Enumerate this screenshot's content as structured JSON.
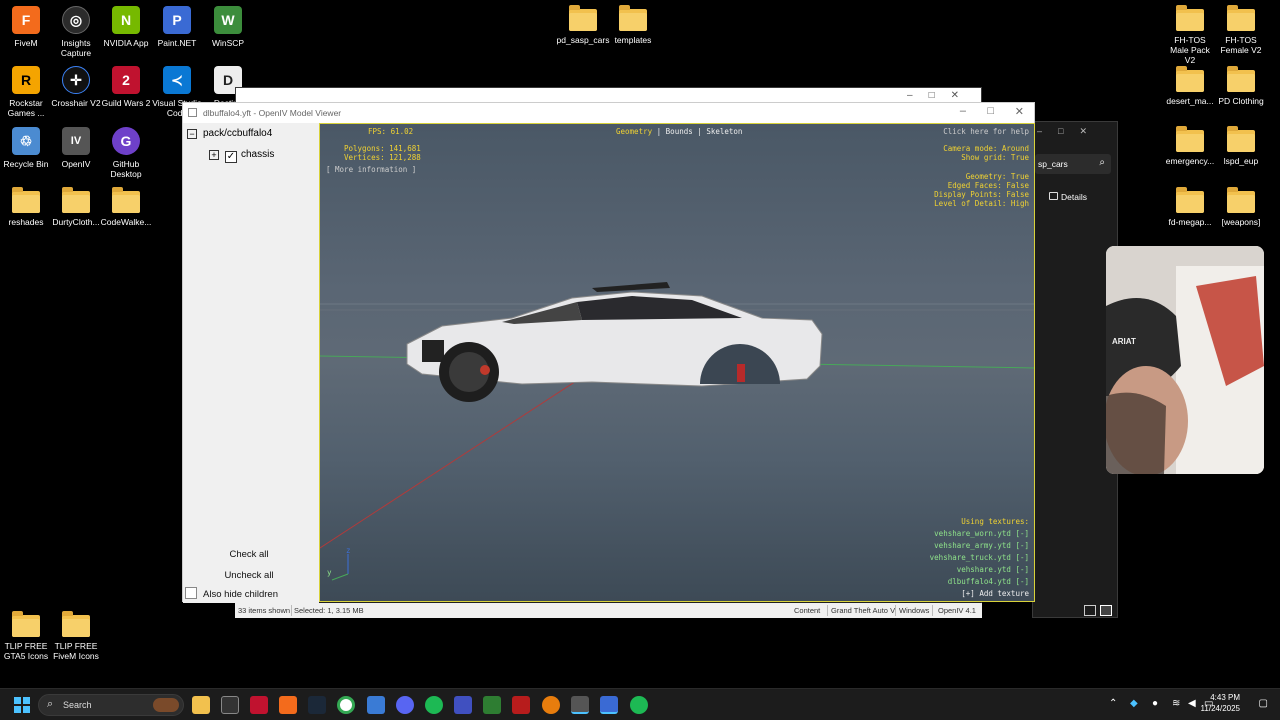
{
  "desktop": {
    "left_icons": [
      {
        "label": "FiveM",
        "color": "#f36b1c",
        "glyph": "F"
      },
      {
        "label": "Insights Capture",
        "color": "#2b2b2b",
        "glyph": "◎"
      },
      {
        "label": "NVIDIA App",
        "color": "#76b900",
        "glyph": "N"
      },
      {
        "label": "Paint.NET",
        "color": "#3a6ad4",
        "glyph": "P"
      },
      {
        "label": "WinSCP",
        "color": "#3c8d3c",
        "glyph": "W"
      },
      {
        "label": "Rockstar Games ...",
        "color": "#f4a400",
        "glyph": "R"
      },
      {
        "label": "Crosshair V2",
        "color": "#111111",
        "glyph": "✛"
      },
      {
        "label": "Guild Wars 2",
        "color": "#c0122f",
        "glyph": "2"
      },
      {
        "label": "Visual Studio Code",
        "color": "#0a78d4",
        "glyph": "≺"
      },
      {
        "label": "Destiny",
        "color": "#eeeeee",
        "glyph": "D"
      },
      {
        "label": "Recycle Bin",
        "color": "#4b8bd1",
        "glyph": "♲"
      },
      {
        "label": "OpenIV",
        "color": "#555555",
        "glyph": "IV"
      },
      {
        "label": "GitHub Desktop",
        "color": "#6e40c9",
        "glyph": "G"
      }
    ],
    "left_folders": [
      "reshades",
      "DurtyCloth...",
      "CodeWalke..."
    ],
    "bottom_left_folders": [
      "TLIP FREE GTA5 Icons",
      "TLIP FREE FiveM Icons"
    ],
    "top_center_folders": [
      "pd_sasp_cars",
      "templates"
    ],
    "right_folders": [
      "FH-TOS Male Pack V2",
      "FH-TOS Female V2",
      "desert_ma...",
      "PD Clothing",
      "emergency...",
      "lspd_eup",
      "fd-megap...",
      "[weapons]"
    ]
  },
  "explorer": {
    "search_text": "sp_cars",
    "details_label": "Details",
    "status": {
      "items_shown": "33 items shown",
      "selected": "Selected: 1,  3.15 MB",
      "content": "Content",
      "game": "Grand Theft Auto V",
      "platform": "Windows",
      "version": "OpenIV 4.1"
    }
  },
  "viewer": {
    "window_title": "dlbuffalo4.yft - OpenIV Model Viewer",
    "tree": {
      "root": "pack/ccbuffalo4",
      "child": "chassis",
      "check_all": "Check all",
      "uncheck_all": "Uncheck all",
      "also_hide": "Also hide children"
    },
    "overlay": {
      "fps": "FPS: 61.02",
      "polygons": "Polygons: 141,681",
      "vertices": "Vertices: 121,288",
      "more_info": "[ More information ]",
      "mode_geometry": "Geometry",
      "mode_sep1": "|",
      "mode_bounds": "Bounds",
      "mode_sep2": "|",
      "mode_skeleton": "Skeleton",
      "help": "Click here for help",
      "camera_mode": "Camera mode: Around",
      "show_grid": "Show grid: True",
      "geometry": "Geometry: True",
      "edged_faces": "Edged Faces: False",
      "display_points": "Display Points: False",
      "lod": "Level of Detail: High",
      "using_textures": "Using textures:",
      "textures": [
        "vehshare_worn.ytd [-]",
        "vehshare_army.ytd [-]",
        "vehshare_truck.ytd [-]",
        "vehshare.ytd [-]",
        "dlbuffalo4.ytd [-]"
      ],
      "add_texture": "[+] Add texture",
      "axis_y": "y",
      "axis_z": "z"
    }
  },
  "webcam": {
    "cap_text": "ARIAT"
  },
  "taskbar": {
    "search_placeholder": "Search",
    "time": "4:43 PM",
    "date": "11/24/2025"
  }
}
